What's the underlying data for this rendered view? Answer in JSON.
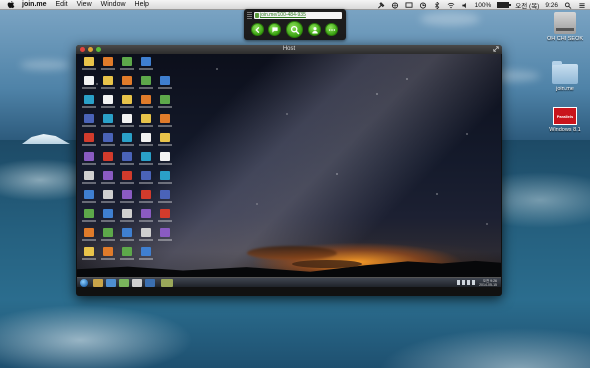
{
  "menubar": {
    "app_name": "join.me",
    "items": [
      "Edit",
      "View",
      "Window",
      "Help"
    ],
    "clock": "9:26",
    "day": "오전 (목)",
    "battery_percent": "100%",
    "battery_level": 1.0
  },
  "joinme": {
    "url": "join.me/100-484-935"
  },
  "desktop_icons": [
    {
      "label": "OH CHI SEOK",
      "icon": "hard-drive-icon"
    },
    {
      "label": "join.me",
      "icon": "folder-icon"
    },
    {
      "label": "Windows 8.1",
      "icon": "parallels-icon"
    }
  ],
  "host_window": {
    "title": "Host"
  },
  "windows_guest": {
    "taskbar_time": "오전 9:26",
    "taskbar_date": "2014-05-15"
  },
  "colors": {
    "accent_green": "#3aa312",
    "link_green": "#2f7d20",
    "parallels_red": "#c9141c"
  }
}
